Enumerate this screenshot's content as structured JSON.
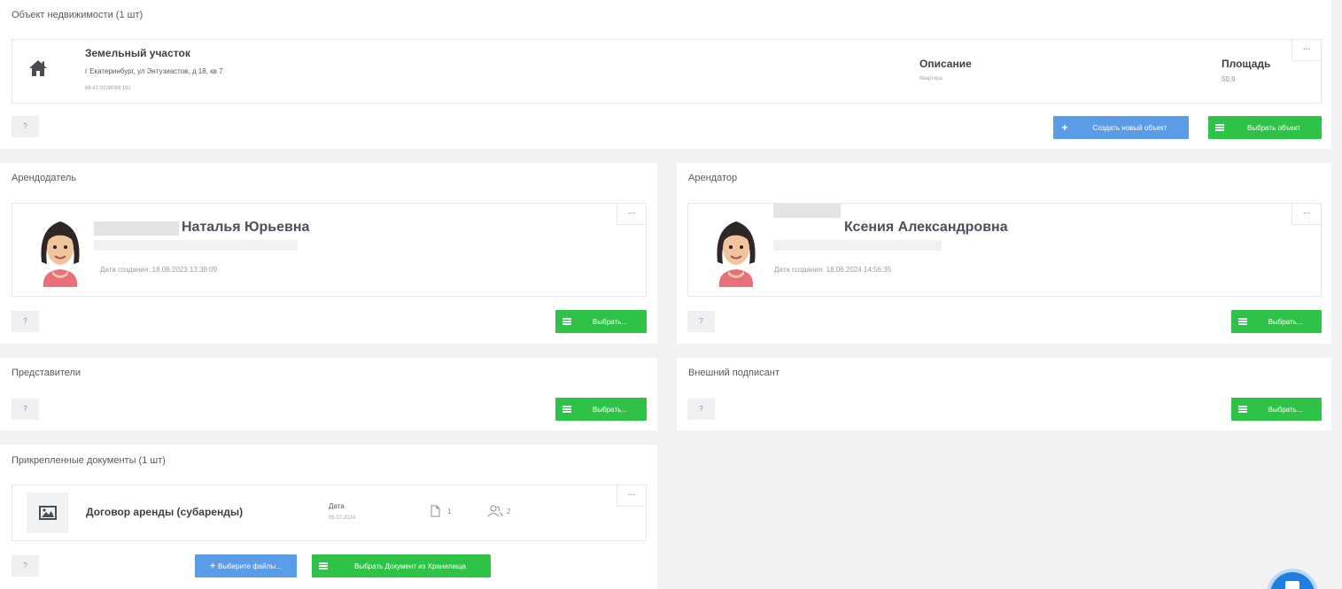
{
  "property": {
    "section_title": "Объект недвижимости (1 шт)",
    "name": "Земельный участок",
    "address": "г Екатеринбург, ул Энтузиастов, д 18, кв 7",
    "cadastral": "66:41:0108089:191",
    "description_label": "Описание",
    "description_value": "Квартира",
    "area_label": "Площадь",
    "area_value": "50,9",
    "menu_label": "...",
    "help_label": "?",
    "create_button": "Создать новый объект",
    "select_button": "Выбрать объект"
  },
  "landlord": {
    "section_title": "Арендодатель",
    "name": "Наталья Юрьевна",
    "created": "Дата создания: 18.06.2023 13:38:09",
    "menu_label": "...",
    "help_label": "?",
    "select_button": "Выбрать..."
  },
  "tenant": {
    "section_title": "Арендатор",
    "name": "Ксения Александровна",
    "created": "Дата создания: 18.06.2024 14:56:35",
    "menu_label": "...",
    "help_label": "?",
    "select_button": "Выбрать..."
  },
  "representatives": {
    "section_title": "Представители",
    "help_label": "?",
    "select_button": "Выбрать..."
  },
  "external_signer": {
    "section_title": "Внешний подписант",
    "help_label": "?",
    "select_button": "Выбрать..."
  },
  "documents": {
    "section_title": "Прикрепленные документы (1 шт)",
    "doc_name": "Договор аренды (субаренды)",
    "date_label": "Дата",
    "date_value": "05.07.2024",
    "files_count": "1",
    "signers_count": "2",
    "menu_label": "...",
    "help_label": "?",
    "choose_files_button": "Выберите файлы...",
    "storage_button": "Выбрать Документ из Хранилища"
  },
  "colors": {
    "green": "#2ec246",
    "blue": "#5b9ce9",
    "chat_blue": "#1f7fe0"
  },
  "icons": [
    "home-icon",
    "plus-icon",
    "list-icon",
    "image-icon",
    "file-icon",
    "users-icon",
    "chat-icon"
  ]
}
